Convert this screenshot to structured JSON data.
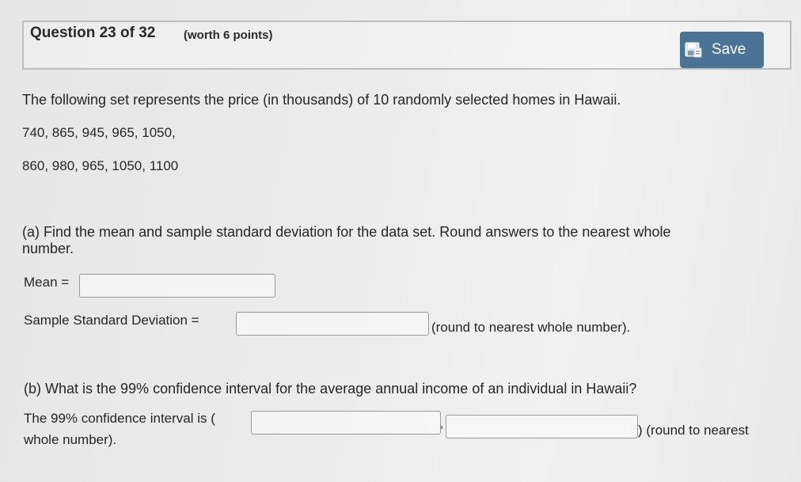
{
  "header": {
    "question_label": "Question 23 of 32",
    "worth_label": "(worth 6 points)",
    "save_label": "Save",
    "save_icon": "save-disk-icon"
  },
  "problem": {
    "intro": "The following set represents the price (in thousands) of 10 randomly selected homes in Hawaii.",
    "data_line_1": "740, 865, 945, 965, 1050,",
    "data_line_2": "860, 980, 965, 1050, 1100"
  },
  "part_a": {
    "prompt_line_1": "(a) Find the mean and sample standard deviation for the data set. Round answers to the nearest whole",
    "prompt_line_2": "number.",
    "mean_label": "Mean =",
    "mean_value": "",
    "sd_label": "Sample Standard Deviation =",
    "sd_value": "",
    "sd_hint": "(round to nearest whole number)."
  },
  "part_b": {
    "prompt": "(b) What is the 99% confidence interval for the average annual income of an individual in Hawaii?",
    "ci_label": "The 99% confidence interval is (",
    "ci_lower_value": "",
    "ci_separator": ",",
    "ci_upper_value": "",
    "ci_hint": ") (round to nearest",
    "ci_hint_line_2": "whole number)."
  }
}
